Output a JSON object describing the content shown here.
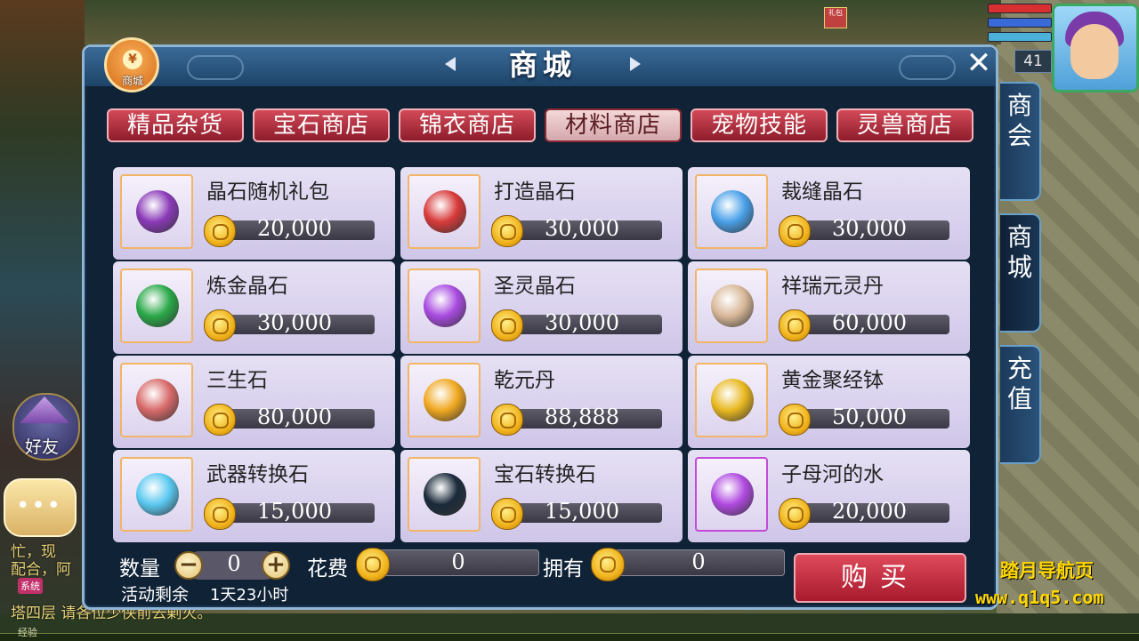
{
  "shop": {
    "title": "商城",
    "badge_label": "商城",
    "badge_symbol": "¥",
    "close_symbol": "✕",
    "categories": [
      {
        "label": "精品杂货",
        "active": false
      },
      {
        "label": "宝石商店",
        "active": false
      },
      {
        "label": "锦衣商店",
        "active": false
      },
      {
        "label": "材料商店",
        "active": true
      },
      {
        "label": "宠物技能",
        "active": false
      },
      {
        "label": "灵兽商店",
        "active": false
      }
    ],
    "items": [
      {
        "name": "晶石随机礼包",
        "price": "20,000",
        "icon": "purple-bag-icon",
        "color": "#8a3ab8"
      },
      {
        "name": "打造晶石",
        "price": "30,000",
        "icon": "red-crystal-icon",
        "color": "#d83a3a"
      },
      {
        "name": "裁缝晶石",
        "price": "30,000",
        "icon": "blue-crystal-icon",
        "color": "#4aa0e8"
      },
      {
        "name": "炼金晶石",
        "price": "30,000",
        "icon": "green-crystal-icon",
        "color": "#2aa848"
      },
      {
        "name": "圣灵晶石",
        "price": "30,000",
        "icon": "purple-crystal-icon",
        "color": "#a84ae0"
      },
      {
        "name": "祥瑞元灵丹",
        "price": "60,000",
        "icon": "gourd-bottle-icon",
        "color": "#d8b898"
      },
      {
        "name": "三生石",
        "price": "80,000",
        "icon": "red-stone-icon",
        "color": "#d86a6a"
      },
      {
        "name": "乾元丹",
        "price": "88,888",
        "icon": "golden-orb-icon",
        "color": "#f0a820"
      },
      {
        "name": "黄金聚经钵",
        "price": "50,000",
        "icon": "golden-bowl-icon",
        "color": "#e8b820"
      },
      {
        "name": "武器转换石",
        "price": "15,000",
        "icon": "blue-flame-icon",
        "color": "#5ac8f0"
      },
      {
        "name": "宝石转换石",
        "price": "15,000",
        "icon": "taiji-disc-icon",
        "color": "#1a2a3a"
      },
      {
        "name": "子母河的水",
        "price": "20,000",
        "icon": "purple-vase-icon",
        "color": "#b04ae0"
      }
    ],
    "quantity_label": "数量",
    "quantity_value": "0",
    "minus_symbol": "−",
    "plus_symbol": "+",
    "cost_label": "花费",
    "cost_value": "0",
    "own_label": "拥有",
    "own_value": "0",
    "buy_label": "购买",
    "remaining_label": "活动剩余",
    "remaining_value": "1天23小时"
  },
  "side_tabs": [
    {
      "label": "商会",
      "active": false
    },
    {
      "label": "商城",
      "active": true
    },
    {
      "label": "充值",
      "active": false
    }
  ],
  "hud": {
    "level": "41",
    "friend_label": "好友",
    "chat_lines": [
      "忙，现",
      "配合，阿",
      "塔四层 请各位少侠前去剿灭。"
    ],
    "system_tag": "系统",
    "exp_label": "经验",
    "bag_label": "礼包"
  },
  "watermark": {
    "line1": "踏月导航页",
    "line2": "www.q1q5.com"
  },
  "colors": {
    "panel": "#0f2236",
    "tab_red": "#b2303e",
    "card": "#ddd6ee",
    "coin": "#f0b21a"
  }
}
